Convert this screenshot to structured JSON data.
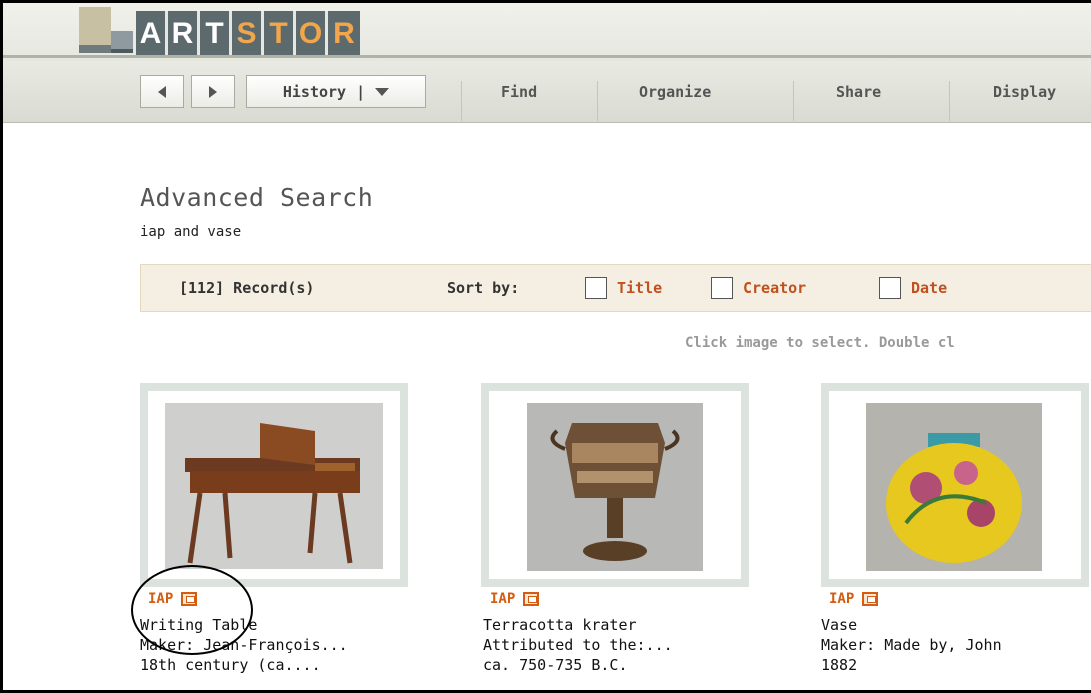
{
  "logo": {
    "letters": [
      "A",
      "R",
      "T",
      "S",
      "T",
      "O",
      "R"
    ]
  },
  "nav": {
    "history_label": "History",
    "history_sep": "|",
    "menu": [
      "Find",
      "Organize",
      "Share",
      "Display"
    ]
  },
  "search": {
    "title": "Advanced Search",
    "query": "iap and vase",
    "records": "[112] Record(s)",
    "sort_by": "Sort by:",
    "sort_options": [
      "Title",
      "Creator",
      "Date"
    ],
    "hint": "Click image to select. Double cl"
  },
  "results": [
    {
      "badge": "IAP",
      "title": "Writing Table",
      "line2": "Maker: Jean-François...",
      "line3": "18th century (ca...."
    },
    {
      "badge": "IAP",
      "title": "Terracotta krater",
      "line2": "Attributed to the:...",
      "line3": "ca. 750-735 B.C."
    },
    {
      "badge": "IAP",
      "title": "Vase",
      "line2": "Maker: Made by, John",
      "line3": "1882"
    }
  ],
  "colors": {
    "accent": "#d35d12",
    "sort_orange": "#c0501f",
    "logo_bg": "#5c6a6d",
    "logo_highlight": "#f2a64b"
  },
  "icons": [
    "back-arrow-icon",
    "forward-arrow-icon",
    "dropdown-icon",
    "image-group-icon"
  ]
}
